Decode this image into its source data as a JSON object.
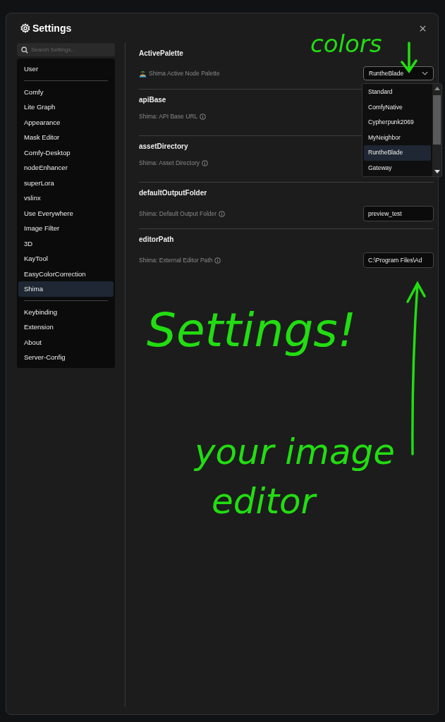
{
  "dialog": {
    "title": "Settings"
  },
  "sidebar": {
    "search": {
      "placeholder": "Search Settings..."
    },
    "groups": [
      {
        "items": [
          {
            "label": "User",
            "selected": false
          }
        ]
      },
      {
        "items": [
          {
            "label": "Comfy",
            "selected": false
          },
          {
            "label": "Lite Graph",
            "selected": false
          },
          {
            "label": "Appearance",
            "selected": false
          },
          {
            "label": "Mask Editor",
            "selected": false
          },
          {
            "label": "Comfy-Desktop",
            "selected": false
          },
          {
            "label": "nodeEnhancer",
            "selected": false
          },
          {
            "label": "superLora",
            "selected": false
          },
          {
            "label": "vslinx",
            "selected": false
          },
          {
            "label": "Use Everywhere",
            "selected": false
          },
          {
            "label": "Image Filter",
            "selected": false
          },
          {
            "label": "3D",
            "selected": false
          },
          {
            "label": "KayTool",
            "selected": false
          },
          {
            "label": "EasyColorCorrection",
            "selected": false
          },
          {
            "label": "Shima",
            "selected": true
          }
        ]
      },
      {
        "items": [
          {
            "label": "Keybinding",
            "selected": false
          },
          {
            "label": "Extension",
            "selected": false
          },
          {
            "label": "About",
            "selected": false
          },
          {
            "label": "Server-Config",
            "selected": false
          }
        ]
      }
    ]
  },
  "settings": [
    {
      "heading": "ActivePalette",
      "label": "Shima Active Node Palette",
      "kind": "select",
      "value": "RuntheBlade",
      "expanded": true,
      "options": [
        {
          "label": "Standard",
          "selected": false
        },
        {
          "label": "ComfyNative",
          "selected": false
        },
        {
          "label": "Cypherpunk2069",
          "selected": false
        },
        {
          "label": "MyNeighbor",
          "selected": false
        },
        {
          "label": "RuntheBlade",
          "selected": true
        },
        {
          "label": "Gateway",
          "selected": false
        }
      ]
    },
    {
      "heading": "apiBase",
      "label": "Shima: API Base URL",
      "kind": "hidden"
    },
    {
      "heading": "assetDirectory",
      "label": "Shima: Asset Directory",
      "kind": "hidden"
    },
    {
      "heading": "defaultOutputFolder",
      "label": "Shima: Default Output Folder",
      "kind": "text",
      "value": "preview_test"
    },
    {
      "heading": "editorPath",
      "label": "Shima: External Editor Path",
      "kind": "text",
      "value": "C:\\Program Files\\Ad"
    }
  ],
  "annotations": [
    {
      "text": "colors",
      "kind": "colors"
    },
    {
      "text": "Settings!",
      "kind": "title"
    },
    {
      "text": "your image",
      "kind": "line1"
    },
    {
      "text": "editor",
      "kind": "line2"
    }
  ]
}
